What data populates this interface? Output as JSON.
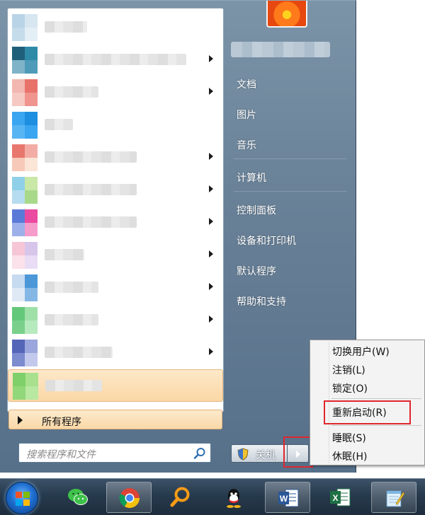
{
  "left_pane": {
    "programs": [
      {
        "colors": [
          "#b9d4e6",
          "#d7e6f0",
          "#c5dceb",
          "#e3eef5"
        ],
        "label_width": 60,
        "has_submenu": false
      },
      {
        "colors": [
          "#1f5f7a",
          "#2f8aa8",
          "#7fb3c8",
          "#4d9bb8"
        ],
        "label_width": 200,
        "has_submenu": true
      },
      {
        "colors": [
          "#f2b7b0",
          "#e8726a",
          "#f6c9c3",
          "#ef958d"
        ],
        "label_width": 76,
        "has_submenu": true
      },
      {
        "colors": [
          "#3aa5f0",
          "#1e8ee0",
          "#58b5f4",
          "#3aa5f0"
        ],
        "label_width": 40,
        "has_submenu": false
      },
      {
        "colors": [
          "#e8776e",
          "#f2aca5",
          "#f6c9b8",
          "#fbe5d6"
        ],
        "label_width": 130,
        "has_submenu": true
      },
      {
        "colors": [
          "#8fd0e8",
          "#c9e7a6",
          "#b6dcef",
          "#a8d98a"
        ],
        "label_width": 130,
        "has_submenu": true
      },
      {
        "colors": [
          "#5b7ad8",
          "#ea4aa0",
          "#9db0ea",
          "#f59ccb"
        ],
        "label_width": 130,
        "has_submenu": true
      },
      {
        "colors": [
          "#f6c6d6",
          "#d8c6ea",
          "#fbe1ea",
          "#e9dcf5"
        ],
        "label_width": 56,
        "has_submenu": true
      },
      {
        "colors": [
          "#c6daf0",
          "#4b97d8",
          "#dfe9f5",
          "#84b7e4"
        ],
        "label_width": 76,
        "has_submenu": true
      },
      {
        "colors": [
          "#64c87a",
          "#9ee0a8",
          "#7ad08b",
          "#b7e9be"
        ],
        "label_width": 76,
        "has_submenu": true
      },
      {
        "colors": [
          "#5566b8",
          "#9aa6dc",
          "#7d8bcf",
          "#c2c9ec"
        ],
        "label_width": 96,
        "has_submenu": true
      },
      {
        "colors": [
          "#7fd06a",
          "#a8e08e",
          "#92d77a",
          "#b8e8a2"
        ],
        "label_width": 80,
        "has_submenu": false,
        "highlighted": true
      }
    ],
    "all_programs_label": "所有程序",
    "search_placeholder": "搜索程序和文件"
  },
  "right_pane": {
    "items": [
      "文档",
      "图片",
      "音乐",
      "计算机",
      "控制面板",
      "设备和打印机",
      "默认程序",
      "帮助和支持"
    ],
    "shutdown_label": "关机"
  },
  "context_menu": {
    "items": [
      "切换用户(W)",
      "注销(L)",
      "锁定(O)",
      "重新启动(R)",
      "睡眠(S)",
      "休眠(H)"
    ]
  },
  "taskbar": {
    "apps": [
      "wechat-icon",
      "chrome-icon",
      "search-app-icon",
      "qq-icon",
      "word-icon",
      "excel-icon",
      "notepad-icon"
    ]
  },
  "colors": {
    "highlight_red": "#e0272d",
    "menu_bg": "#6a8298"
  }
}
